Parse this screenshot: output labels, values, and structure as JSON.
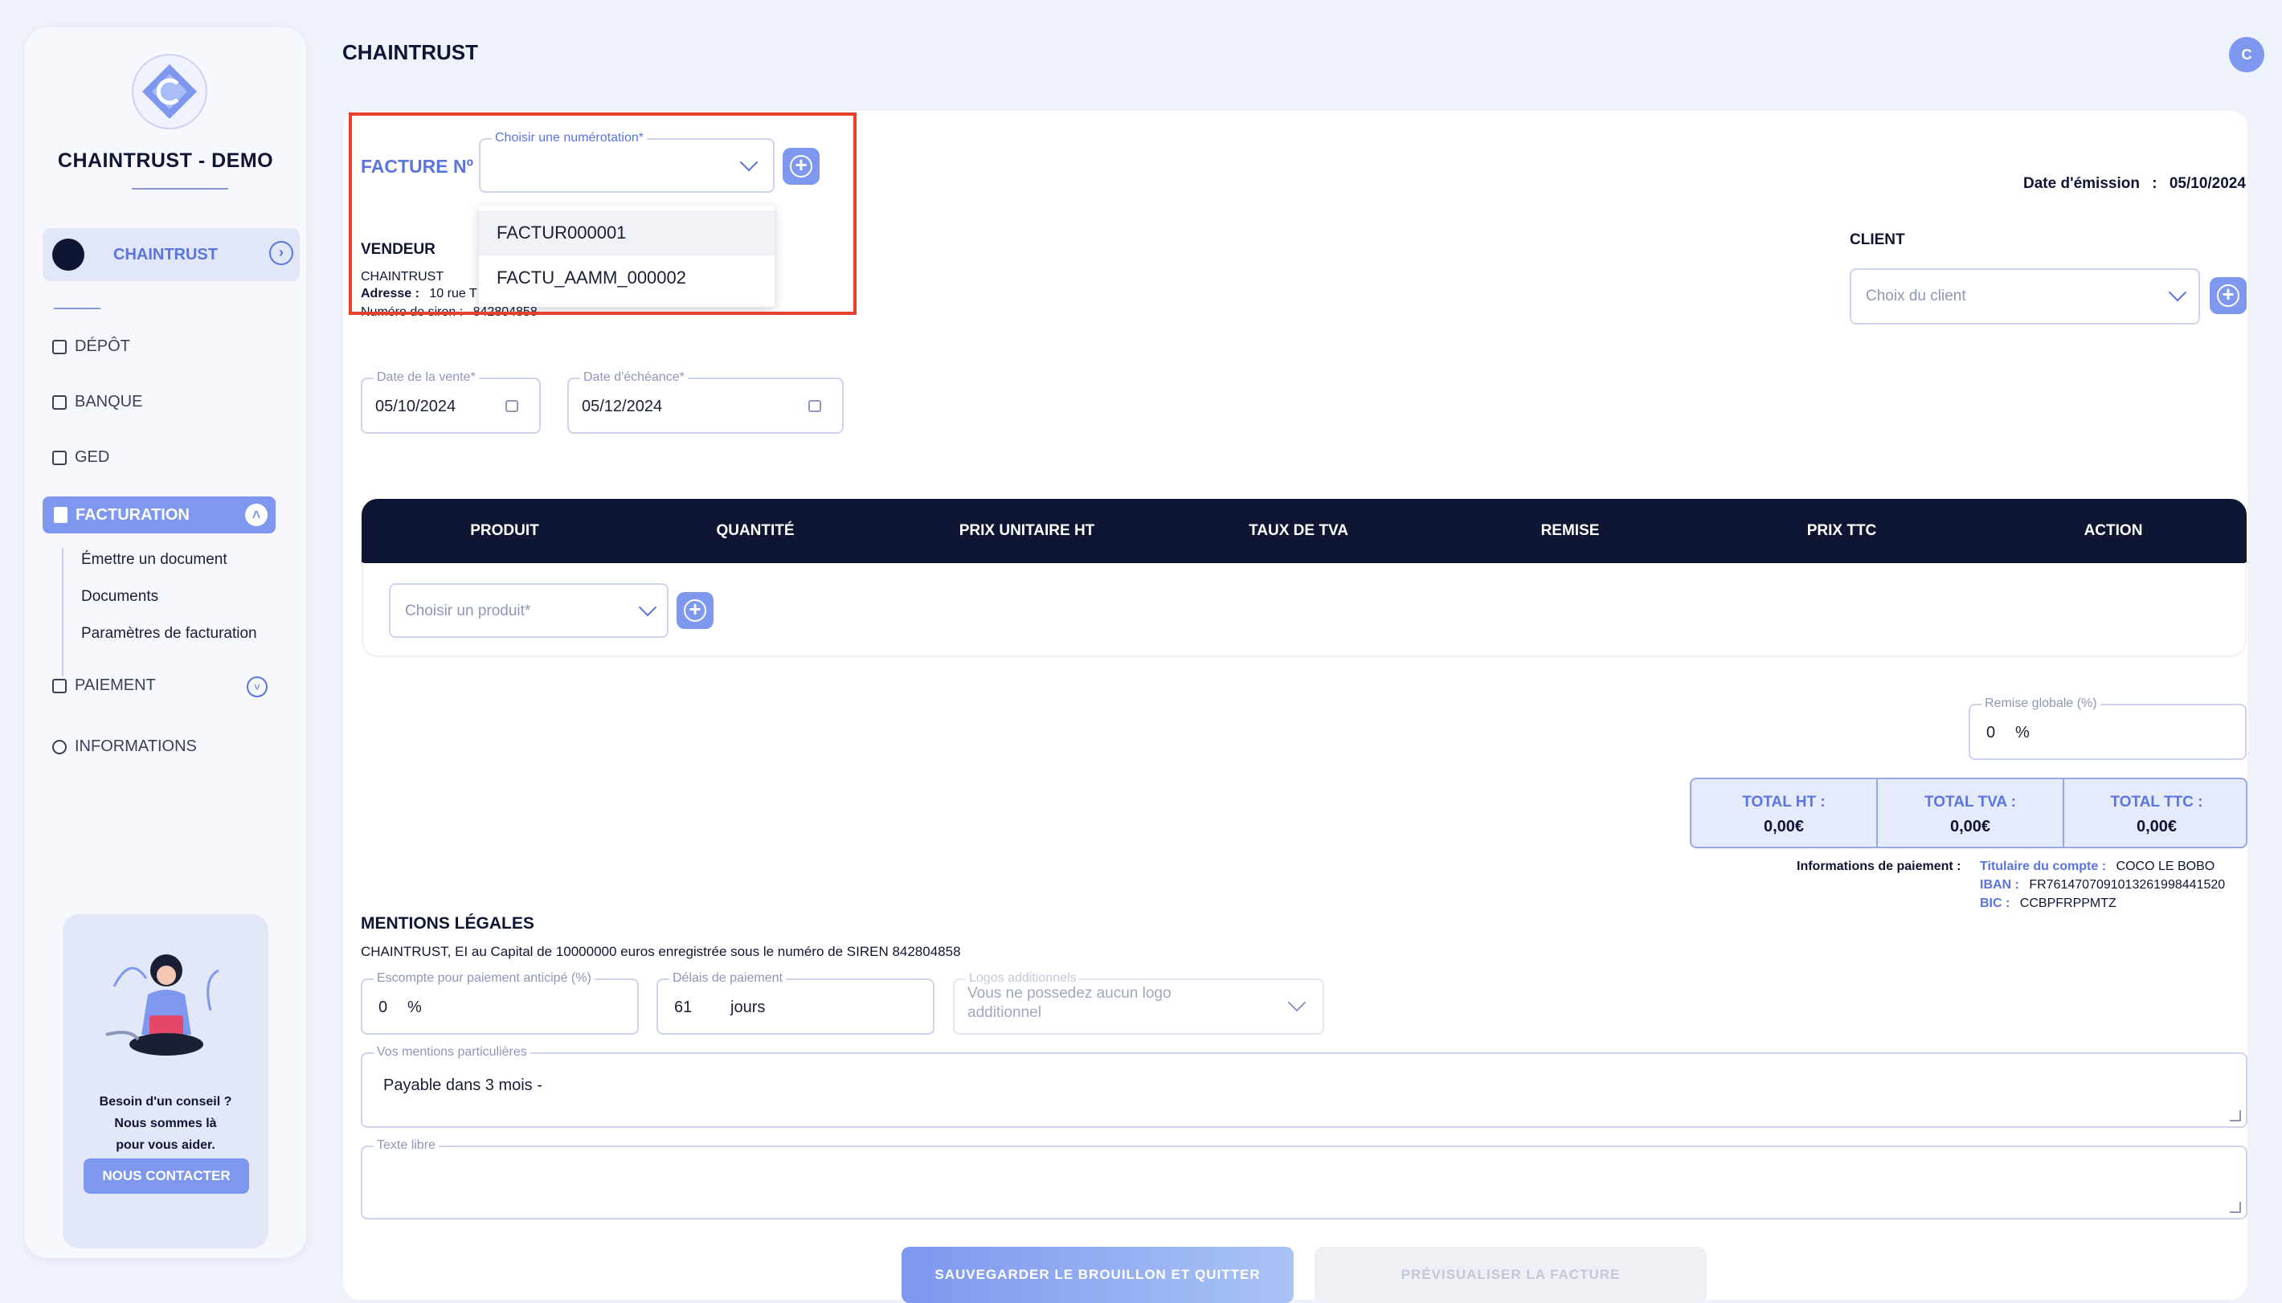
{
  "sidebar": {
    "brand": "CHAINTRUST - DEMO",
    "company": "CHAINTRUST",
    "nav": {
      "depot": "DÉPÔT",
      "banque": "BANQUE",
      "ged": "GED",
      "facturation": "FACTURATION",
      "paiement": "PAIEMENT",
      "informations": "INFORMATIONS"
    },
    "sub_items": [
      "Émettre un document",
      "Documents",
      "Paramètres de facturation"
    ],
    "help": {
      "line1": "Besoin d'un conseil ?",
      "line2": "Nous sommes là",
      "line3": "pour vous aider.",
      "button": "NOUS CONTACTER"
    }
  },
  "header": {
    "title": "CHAINTRUST",
    "avatar_initial": "C"
  },
  "invoice": {
    "number_label": "FACTURE Nº",
    "numbering_legend": "Choisir une numérotation*",
    "numbering_options": [
      "FACTUR000001",
      "FACTU_AAMM_000002"
    ],
    "issue_date_label": "Date d'émission",
    "issue_date_sep": ":",
    "issue_date": "05/10/2024"
  },
  "vendor": {
    "title": "VENDEUR",
    "name": "CHAINTRUST",
    "address_label": "Adresse :",
    "address": "10 rue T",
    "siren_label": "Numéro de siren :",
    "siren": "842804858"
  },
  "client": {
    "title": "CLIENT",
    "placeholder": "Choix du client"
  },
  "dates": {
    "sale_legend": "Date de la vente*",
    "sale_value": "05/10/2024",
    "due_legend": "Date d'échéance*",
    "due_value": "05/12/2024"
  },
  "table": {
    "headers": [
      "PRODUIT",
      "QUANTITÉ",
      "PRIX UNITAIRE HT",
      "TAUX DE TVA",
      "REMISE",
      "PRIX TTC",
      "ACTION"
    ],
    "product_placeholder": "Choisir un produit*"
  },
  "discount": {
    "legend": "Remise globale (%)",
    "value": "0",
    "unit": "%"
  },
  "totals": {
    "ht_label": "TOTAL HT :",
    "ht_value": "0,00€",
    "tva_label": "TOTAL TVA :",
    "tva_value": "0,00€",
    "ttc_label": "TOTAL TTC :",
    "ttc_value": "0,00€"
  },
  "payment": {
    "title": "Informations de paiement :",
    "holder_label": "Titulaire du compte :",
    "holder": "COCO LE BOBO",
    "iban_label": "IBAN :",
    "iban": "FR7614707091013261998441520",
    "bic_label": "BIC :",
    "bic": "CCBPFRPPMTZ"
  },
  "legal": {
    "title": "MENTIONS LÉGALES",
    "text": "CHAINTRUST, EI au Capital de 10000000 euros enregistrée sous le numéro de SIREN 842804858",
    "escompte_legend": "Escompte pour paiement anticipé (%)",
    "escompte_value": "0",
    "escompte_unit": "%",
    "delai_legend": "Délais de paiement",
    "delai_value": "61",
    "delai_unit": "jours",
    "logos_legend": "Logos additionnels",
    "logos_placeholder_1": "Vous ne possedez aucun logo",
    "logos_placeholder_2": "additionnel",
    "mentions_legend": "Vos mentions particulières",
    "mentions_value": "Payable dans 3 mois -",
    "libre_legend": "Texte libre"
  },
  "actions": {
    "save": "SAUVEGARDER LE BROUILLON ET QUITTER",
    "preview": "PRÉVISUALISER LA FACTURE"
  },
  "colors": {
    "accent": "#7e97ef",
    "navy": "#0f1633",
    "highlight": "#e5412b"
  }
}
